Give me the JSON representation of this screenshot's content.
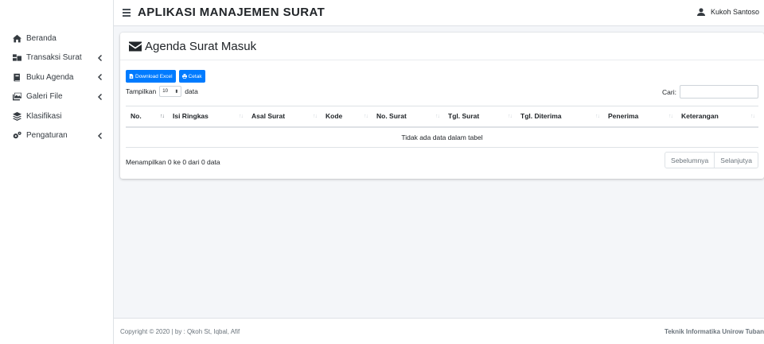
{
  "header": {
    "title": "APLIKASI MANAJEMEN SURAT",
    "user_name": "Kukoh Santoso"
  },
  "sidebar": {
    "items": [
      {
        "label": "Beranda",
        "icon": "home-icon"
      },
      {
        "label": "Transaksi Surat",
        "icon": "mail-bulk-icon"
      },
      {
        "label": "Buku Agenda",
        "icon": "book-icon"
      },
      {
        "label": "Galeri File",
        "icon": "images-icon"
      },
      {
        "label": "Klasifikasi",
        "icon": "layer-group-icon"
      },
      {
        "label": "Pengaturan",
        "icon": "cogs-icon"
      }
    ]
  },
  "card": {
    "title": "Agenda Surat Masuk",
    "buttons": {
      "excel": "Download Excel",
      "print": "Cetak"
    },
    "length": {
      "prefix": "Tampilkan",
      "value": "10",
      "suffix": "data"
    },
    "search": {
      "label": "Cari:",
      "value": ""
    },
    "table": {
      "columns": [
        "No.",
        "Isi Ringkas",
        "Asal Surat",
        "Kode",
        "No. Surat",
        "Tgl. Surat",
        "Tgl. Diterima",
        "Penerima",
        "Keterangan"
      ],
      "empty_message": "Tidak ada data dalam tabel"
    },
    "info": "Menampilkan 0 ke 0 dari 0 data",
    "pagination": {
      "prev": "Sebelumnya",
      "next": "Selanjutya"
    }
  },
  "footer": {
    "left": "Copyright © 2020 | by : Qkoh St, Iqbal, Afif",
    "right": "Teknik Informatika Unirow Tuban"
  },
  "colors": {
    "primary": "#007bff",
    "background": "#f4f6f9",
    "sidebar": "#ffffff"
  }
}
